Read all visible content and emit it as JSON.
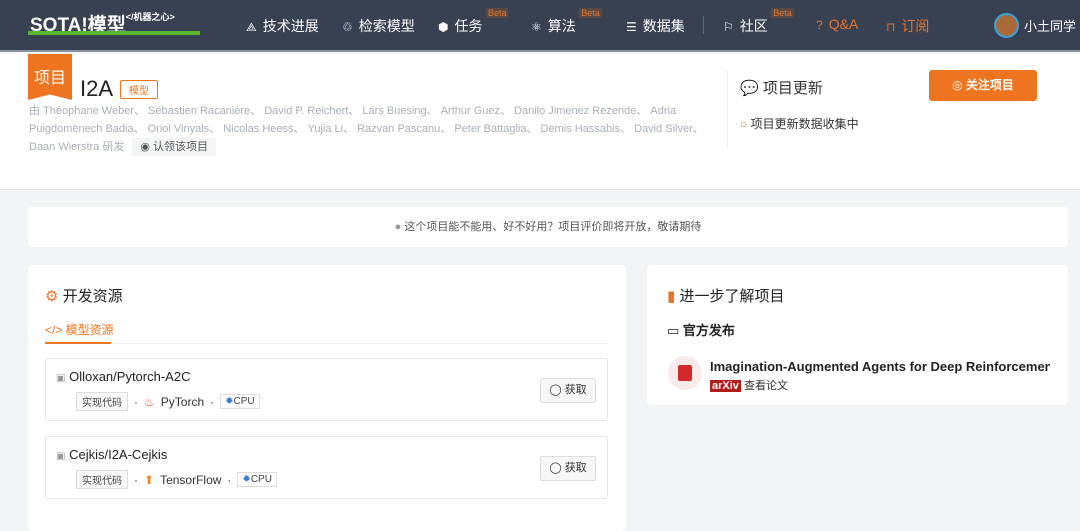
{
  "nav": {
    "logo": "SOTA!模型",
    "logo_sub": "</机器之心>",
    "items": [
      {
        "label": "技术进展",
        "icon": "⟁"
      },
      {
        "label": "检索模型",
        "icon": "♲"
      },
      {
        "label": "任务",
        "icon": "⬢",
        "beta": "Beta"
      },
      {
        "label": "算法",
        "icon": "⚛",
        "beta": "Beta"
      },
      {
        "label": "数据集",
        "icon": "☰"
      },
      {
        "label": "社区",
        "icon": "⚐",
        "beta": "Beta"
      },
      {
        "label": "Q&A",
        "icon": "?"
      },
      {
        "label": "订阅",
        "icon": "⊓"
      }
    ],
    "user": "小土同学"
  },
  "project": {
    "ribbon": "项目",
    "title": "I2A",
    "tag": "模型",
    "authors": "由 Théophane Weber、 Sébastien Racanière、 David P. Reichert、 Lars Buesing、 Arthur Guez、 Danilo Jimenez Rezende、 Adria Puigdomènech Badia、 Oriol Vinyals、 Nicolas Heess、 Yujia Li、 Razvan Pascanu、 Peter Battaglia、 Demis Hassabis、 David Silver、 Daan Wierstra 研发",
    "claim": "认领该项目"
  },
  "updates": {
    "title": "项目更新",
    "status": "项目更新数据收集中",
    "follow": "关注项目"
  },
  "notice": "这个项目能不能用、好不好用？项目评价即将开放，敬请期待",
  "dev": {
    "title": "开发资源",
    "tab": "</> 模型资源",
    "resources": [
      {
        "name": "Olloxan/Pytorch-A2C",
        "type": "实现代码",
        "framework": "PyTorch",
        "framework_icon": "🔥",
        "hw": "CPU",
        "button": "获取"
      },
      {
        "name": "Cejkis/I2A-Cejkis",
        "type": "实现代码",
        "framework": "TensorFlow",
        "framework_icon": "↑",
        "hw": "CPU",
        "button": "获取"
      }
    ]
  },
  "learn": {
    "title": "进一步了解项目",
    "section": "官方发布",
    "paper": "Imagination-Augmented Agents for Deep Reinforcement…",
    "source": "arXiv",
    "link": "查看论文"
  }
}
